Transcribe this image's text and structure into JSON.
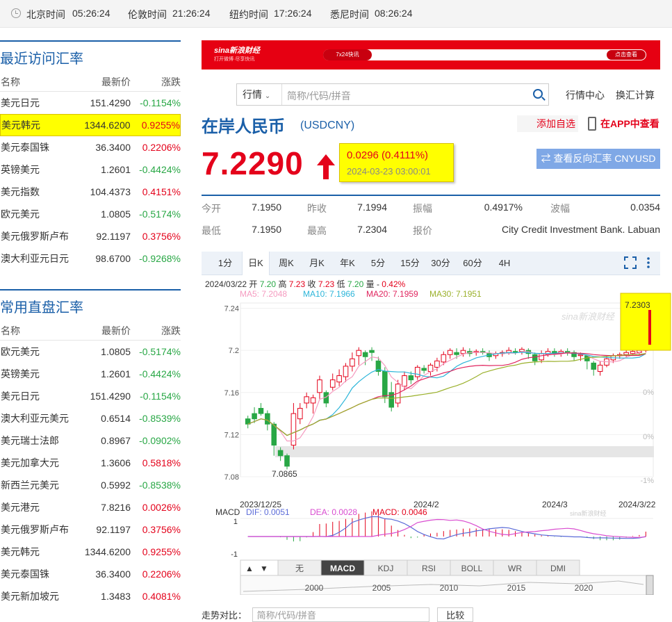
{
  "clock_bar": [
    {
      "city": "北京时间",
      "time": "05:26:24"
    },
    {
      "city": "伦敦时间",
      "time": "21:26:24"
    },
    {
      "city": "纽约时间",
      "time": "17:26:24"
    },
    {
      "city": "悉尼时间",
      "time": "08:26:24"
    }
  ],
  "recent": {
    "title": "最近访问汇率",
    "headers": [
      "名称",
      "最新价",
      "涨跌"
    ],
    "rows": [
      {
        "name": "美元日元",
        "price": "151.4290",
        "chg": "-0.1154%"
      },
      {
        "name": "美元韩元",
        "price": "1344.6200",
        "chg": "0.9255%"
      },
      {
        "name": "美元泰国铢",
        "price": "36.3400",
        "chg": "0.2206%"
      },
      {
        "name": "英镑美元",
        "price": "1.2601",
        "chg": "-0.4424%"
      },
      {
        "name": "美元指数",
        "price": "104.4373",
        "chg": "0.4151%"
      },
      {
        "name": "欧元美元",
        "price": "1.0805",
        "chg": "-0.5174%"
      },
      {
        "name": "美元俄罗斯卢布",
        "price": "92.1197",
        "chg": "0.3756%"
      },
      {
        "name": "澳大利亚元日元",
        "price": "98.6700",
        "chg": "-0.9268%"
      }
    ]
  },
  "common": {
    "title": "常用直盘汇率",
    "headers": [
      "名称",
      "最新价",
      "涨跌"
    ],
    "rows": [
      {
        "name": "欧元美元",
        "price": "1.0805",
        "chg": "-0.5174%"
      },
      {
        "name": "英镑美元",
        "price": "1.2601",
        "chg": "-0.4424%"
      },
      {
        "name": "美元日元",
        "price": "151.4290",
        "chg": "-0.1154%"
      },
      {
        "name": "澳大利亚元美元",
        "price": "0.6514",
        "chg": "-0.8539%"
      },
      {
        "name": "美元瑞士法郎",
        "price": "0.8967",
        "chg": "-0.0902%"
      },
      {
        "name": "美元加拿大元",
        "price": "1.3606",
        "chg": "0.5818%"
      },
      {
        "name": "新西兰元美元",
        "price": "0.5992",
        "chg": "-0.8538%"
      },
      {
        "name": "美元港元",
        "price": "7.8216",
        "chg": "0.0026%"
      },
      {
        "name": "美元俄罗斯卢布",
        "price": "92.1197",
        "chg": "0.3756%"
      },
      {
        "name": "美元韩元",
        "price": "1344.6200",
        "chg": "0.9255%"
      },
      {
        "name": "美元泰国铢",
        "price": "36.3400",
        "chg": "0.2206%"
      },
      {
        "name": "美元新加坡元",
        "price": "1.3483",
        "chg": "0.4081%"
      }
    ]
  },
  "banner": {
    "logo": "sina新浪财经",
    "logo_sub": "打开微博·尽享快讯",
    "tag": "7x24快讯",
    "button": "点击查看"
  },
  "search": {
    "select": "行情",
    "placeholder": "简称/代码/拼音"
  },
  "links": {
    "market_center": "行情中心",
    "converter": "换汇计算"
  },
  "instrument": {
    "name": "在岸人民币",
    "code": "(USDCNY)",
    "add_fav": "添加自选",
    "app": "在APP中查看",
    "price": "7.2290",
    "change": "0.0296 (0.4111%)",
    "time": "2024-03-23 03:00:01",
    "reverse_btn": "查看反向汇率 CNYUSD"
  },
  "stats": [
    {
      "k": "今开",
      "v": "7.1950"
    },
    {
      "k": "昨收",
      "v": "7.1994"
    },
    {
      "k": "振幅",
      "v": "0.4917%"
    },
    {
      "k": "波幅",
      "v": "0.0354"
    },
    {
      "k": "最低",
      "v": "7.1950"
    },
    {
      "k": "最高",
      "v": "7.2304"
    },
    {
      "k": "报价",
      "v": "City Credit Investment Bank. Labuan"
    }
  ],
  "tabs": [
    "1分",
    "日K",
    "周K",
    "月K",
    "年K",
    "5分",
    "15分",
    "30分",
    "60分",
    "4H"
  ],
  "active_tab": "日K",
  "chart_legend": {
    "date": "2024/03/22",
    "open_k": "开",
    "open": "7.20",
    "high_k": "高",
    "high": "7.23",
    "close_k": "收",
    "close": "7.23",
    "low_k": "低",
    "low": "7.20",
    "vol_k": "量",
    "vol": "-",
    "pct": "0.42%",
    "ma5": "MA5: 7.2048",
    "ma10": "MA10: 7.1966",
    "ma20": "MA20: 7.1959",
    "ma30": "MA30: 7.1951",
    "watermark": "sina新浪财经"
  },
  "chart_data": {
    "type": "candlestick",
    "ylim": [
      7.08,
      7.245
    ],
    "y_ticks": [
      "7.24",
      "7.2",
      "7.16",
      "7.12",
      "7.08"
    ],
    "right_ticks": [
      "1%",
      "0%",
      "0%",
      "-1%"
    ],
    "x_ticks": [
      "2023/12/25",
      "2024/2",
      "2024/3",
      "2024/3/22"
    ],
    "last_label": "7.2303",
    "low_label": "7.0865",
    "candles": [
      [
        7.135,
        7.13,
        7.138,
        7.126
      ],
      [
        7.14,
        7.135,
        7.146,
        7.131
      ],
      [
        7.145,
        7.14,
        7.15,
        7.138
      ],
      [
        7.14,
        7.13,
        7.143,
        7.124
      ],
      [
        7.13,
        7.11,
        7.132,
        7.1
      ],
      [
        7.105,
        7.1,
        7.108,
        7.095
      ],
      [
        7.1,
        7.09,
        7.102,
        7.087
      ],
      [
        7.11,
        7.14,
        7.15,
        7.106
      ],
      [
        7.135,
        7.145,
        7.15,
        7.13
      ],
      [
        7.15,
        7.156,
        7.16,
        7.145
      ],
      [
        7.15,
        7.155,
        7.158,
        7.14
      ],
      [
        7.16,
        7.172,
        7.176,
        7.154
      ],
      [
        7.16,
        7.15,
        7.162,
        7.146
      ],
      [
        7.165,
        7.172,
        7.178,
        7.162
      ],
      [
        7.17,
        7.176,
        7.182,
        7.166
      ],
      [
        7.175,
        7.185,
        7.188,
        7.17
      ],
      [
        7.185,
        7.192,
        7.198,
        7.18
      ],
      [
        7.195,
        7.2,
        7.203,
        7.186
      ],
      [
        7.198,
        7.194,
        7.2,
        7.186
      ],
      [
        7.2,
        7.198,
        7.203,
        7.19
      ],
      [
        7.19,
        7.18,
        7.194,
        7.176
      ],
      [
        7.18,
        7.156,
        7.184,
        7.15
      ],
      [
        7.16,
        7.146,
        7.17,
        7.142
      ],
      [
        7.15,
        7.168,
        7.172,
        7.146
      ],
      [
        7.166,
        7.176,
        7.18,
        7.162
      ],
      [
        7.176,
        7.172,
        7.18,
        7.168
      ],
      [
        7.175,
        7.184,
        7.186,
        7.172
      ],
      [
        7.183,
        7.181,
        7.186,
        7.178
      ],
      [
        7.18,
        7.186,
        7.188,
        7.176
      ],
      [
        7.184,
        7.19,
        7.193,
        7.18
      ],
      [
        7.189,
        7.196,
        7.199,
        7.186
      ],
      [
        7.196,
        7.2,
        7.202,
        7.192
      ],
      [
        7.198,
        7.196,
        7.202,
        7.192
      ],
      [
        7.197,
        7.2,
        7.203,
        7.194
      ],
      [
        7.199,
        7.197,
        7.202,
        7.194
      ],
      [
        7.198,
        7.199,
        7.201,
        7.195
      ],
      [
        7.199,
        7.198,
        7.202,
        7.196
      ],
      [
        7.197,
        7.194,
        7.2,
        7.19
      ],
      [
        7.195,
        7.197,
        7.199,
        7.192
      ],
      [
        7.197,
        7.198,
        7.2,
        7.194
      ],
      [
        7.198,
        7.2,
        7.203,
        7.196
      ],
      [
        7.199,
        7.198,
        7.202,
        7.196
      ],
      [
        7.199,
        7.201,
        7.203,
        7.196
      ],
      [
        7.2,
        7.197,
        7.202,
        7.192
      ],
      [
        7.196,
        7.19,
        7.198,
        7.186
      ],
      [
        7.191,
        7.197,
        7.2,
        7.188
      ],
      [
        7.196,
        7.199,
        7.202,
        7.194
      ],
      [
        7.199,
        7.197,
        7.202,
        7.194
      ],
      [
        7.197,
        7.199,
        7.201,
        7.194
      ],
      [
        7.199,
        7.198,
        7.202,
        7.195
      ],
      [
        7.198,
        7.194,
        7.2,
        7.19
      ],
      [
        7.195,
        7.196,
        7.198,
        7.19
      ],
      [
        7.195,
        7.19,
        7.196,
        7.182
      ],
      [
        7.188,
        7.182,
        7.19,
        7.176
      ],
      [
        7.18,
        7.186,
        7.19,
        7.176
      ],
      [
        7.186,
        7.192,
        7.195,
        7.184
      ],
      [
        7.191,
        7.195,
        7.197,
        7.188
      ],
      [
        7.195,
        7.196,
        7.198,
        7.192
      ],
      [
        7.196,
        7.198,
        7.2,
        7.194
      ],
      [
        7.197,
        7.199,
        7.202,
        7.195
      ],
      [
        7.198,
        7.2,
        7.202,
        7.196
      ],
      [
        7.2,
        7.23,
        7.23,
        7.198
      ]
    ]
  },
  "macd": {
    "label": "MACD",
    "dif": "DIF: 0.0051",
    "dea": "DEA: 0.0028",
    "macd": "MACD: 0.0046",
    "y_top": "1",
    "y_bot": "-1"
  },
  "indicators": [
    "无",
    "MACD",
    "KDJ",
    "RSI",
    "BOLL",
    "WR",
    "DMI"
  ],
  "active_indicator": "MACD",
  "overview_years": [
    "2000",
    "2005",
    "2010",
    "2015",
    "2020"
  ],
  "compare": {
    "label": "走势对比：",
    "placeholder": "简称/代码/拼音",
    "btn": "比较"
  }
}
